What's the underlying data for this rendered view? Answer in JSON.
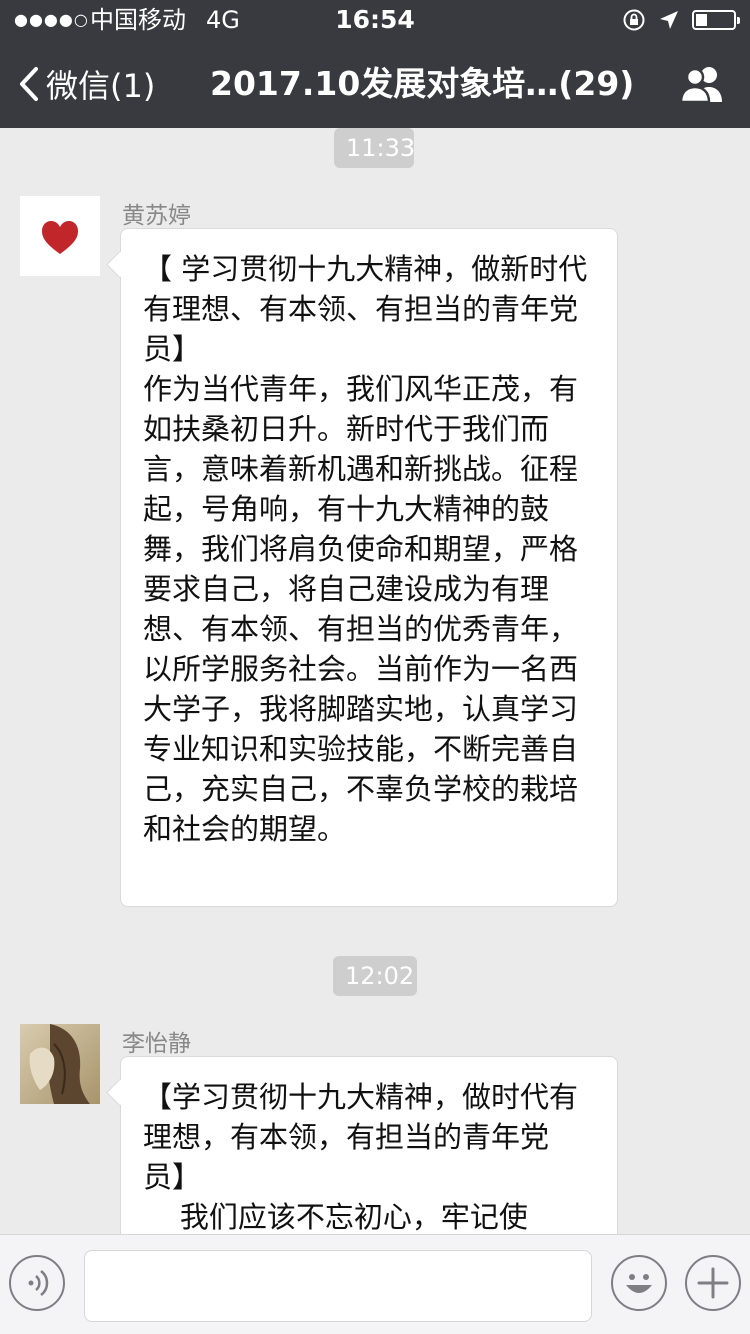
{
  "status_bar": {
    "signal": "●●●●○",
    "carrier": "中国移动",
    "network": "4G",
    "time": "16:54",
    "battery_level": 0.3
  },
  "nav": {
    "back_label": "微信(1)",
    "title": "2017.10发展对象培…(29)"
  },
  "messages": [
    {
      "time": "11:33",
      "sender": "黄苏婷",
      "avatar": "heart-avatar",
      "text": "【 学习贯彻十九大精神，做新时代有理想、有本领、有担当的青年党员】\n作为当代青年，我们风华正茂，有如扶桑初日升。新时代于我们而言，意味着新机遇和新挑战。征程起，号角响，有十九大精神的鼓舞，我们将肩负使命和期望，严格要求自己，将自己建设成为有理想、有本领、有担当的优秀青年，以所学服务社会。当前作为一名西大学子，我将脚踏实地，认真学习专业知识和实验技能，不断完善自己，充实自己，不辜负学校的栽培和社会的期望。"
    },
    {
      "time": "12:02",
      "sender": "李怡静",
      "avatar": "photo-avatar",
      "text": "【学习贯彻十九大精神，做时代有理想，有本领，有担当的青年党员】\n    我们应该不忘初心，牢记使"
    }
  ],
  "colors": {
    "nav_bg": "#393a3f",
    "chat_bg": "#ebebeb",
    "bubble_bg": "#ffffff",
    "heart": "#c0262a"
  }
}
